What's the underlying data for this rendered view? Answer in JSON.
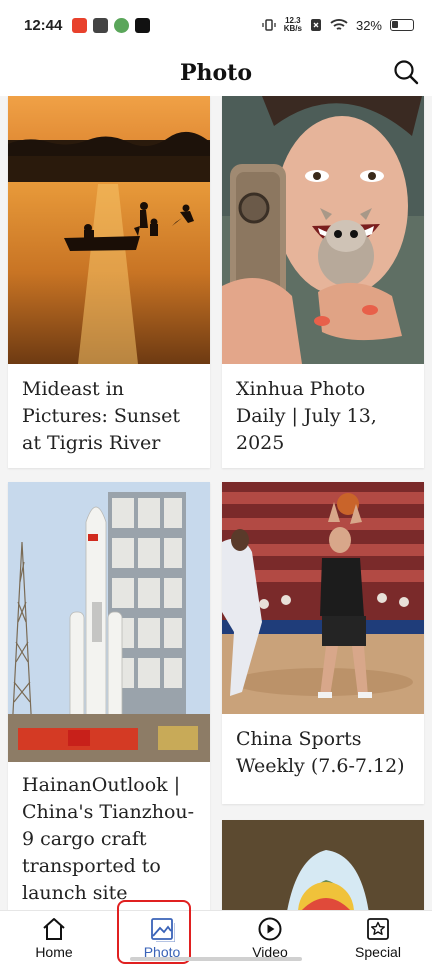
{
  "status_bar": {
    "time": "12:44",
    "speed_top": "12.3",
    "speed_bottom": "KB/s",
    "battery": "32%"
  },
  "header": {
    "title": "Photo",
    "search_icon": "search-icon"
  },
  "feed": {
    "items": [
      {
        "caption": "Mideast in Pictures: Sunset at Tigris River",
        "image": "sunset-river-photo"
      },
      {
        "caption": "Xinhua Photo Daily | July 13, 2025",
        "image": "woman-with-sugar-glider-photo"
      },
      {
        "caption": "HainanOutlook | China's Tianzhou-9 cargo craft transported to launch site",
        "image": "rocket-launch-tower-photo"
      },
      {
        "caption": "China Sports Weekly (7.6-7.12)",
        "image": "basketball-player-photo"
      },
      {
        "caption": "",
        "image": "hot-air-balloon-cave-photo"
      }
    ]
  },
  "bottom_nav": {
    "items": [
      {
        "label": "Home",
        "icon": "home-icon"
      },
      {
        "label": "Photo",
        "icon": "photo-icon",
        "active": true
      },
      {
        "label": "Video",
        "icon": "play-icon"
      },
      {
        "label": "Special",
        "icon": "star-icon"
      }
    ],
    "active_color": "#3a63b8",
    "highlight_color": "#e02020"
  }
}
